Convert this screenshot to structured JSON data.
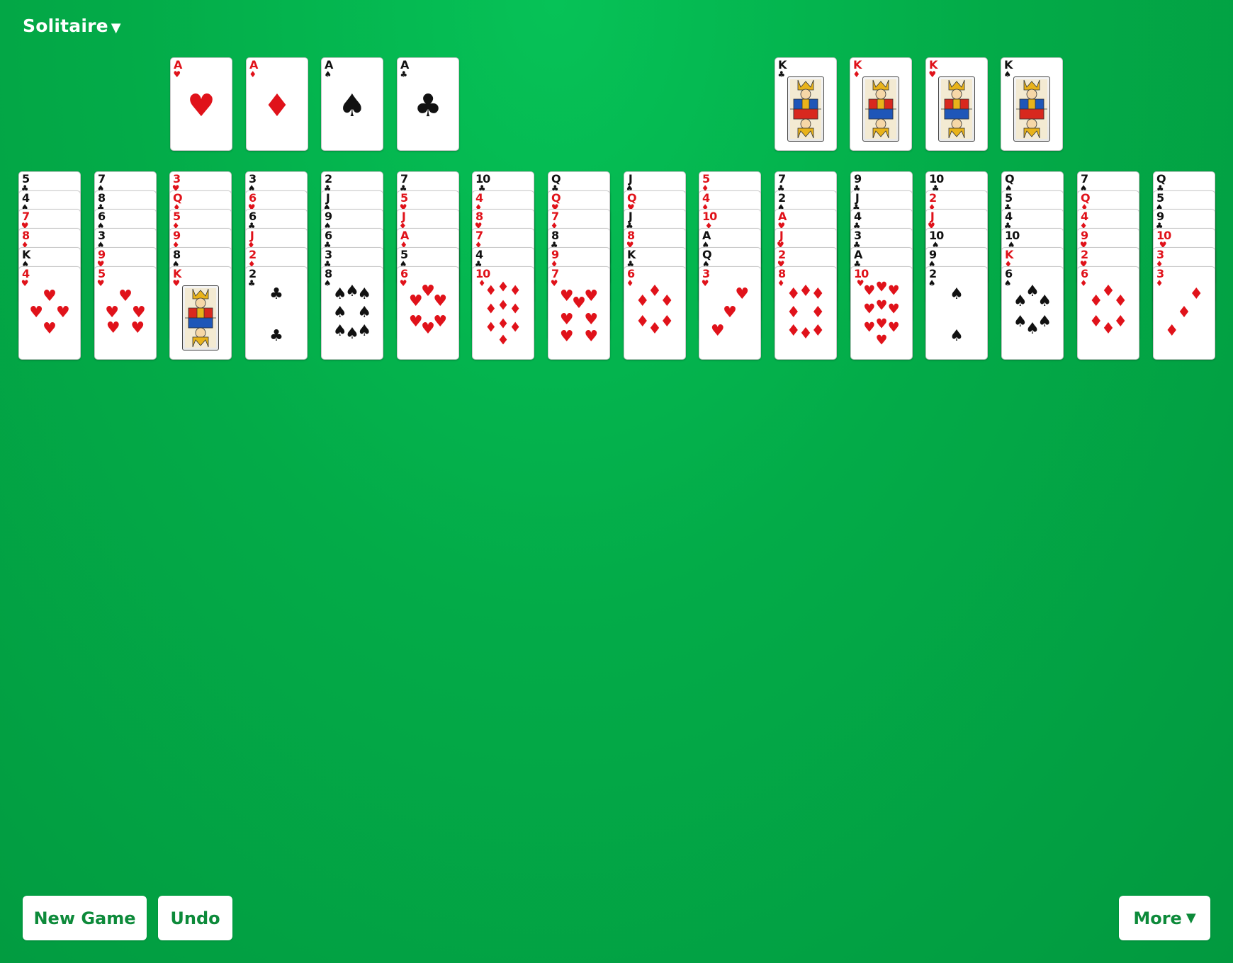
{
  "header": {
    "title": "Solitaire",
    "title_caret": "▼"
  },
  "buttons": {
    "new_game": "New Game",
    "undo": "Undo",
    "more": "More",
    "more_caret": "▼"
  },
  "colors": {
    "felt": "#03ab48",
    "red_suit": "#e0121a",
    "black_suit": "#111111",
    "button_text": "#0d8a3a"
  },
  "suit_symbols": {
    "hearts": "♥",
    "diamonds": "♦",
    "spades": "♠",
    "clubs": "♣"
  },
  "foundations_left": [
    {
      "rank": "A",
      "suit": "hearts"
    },
    {
      "rank": "A",
      "suit": "diamonds"
    },
    {
      "rank": "A",
      "suit": "spades"
    },
    {
      "rank": "A",
      "suit": "clubs"
    }
  ],
  "foundations_right": [
    {
      "rank": "K",
      "suit": "clubs"
    },
    {
      "rank": "K",
      "suit": "diamonds"
    },
    {
      "rank": "K",
      "suit": "hearts"
    },
    {
      "rank": "K",
      "suit": "spades"
    }
  ],
  "tableau": [
    [
      {
        "rank": "5",
        "suit": "clubs"
      },
      {
        "rank": "4",
        "suit": "spades"
      },
      {
        "rank": "7",
        "suit": "hearts"
      },
      {
        "rank": "8",
        "suit": "diamonds"
      },
      {
        "rank": "K",
        "suit": "spades"
      },
      {
        "rank": "4",
        "suit": "hearts"
      }
    ],
    [
      {
        "rank": "7",
        "suit": "spades"
      },
      {
        "rank": "8",
        "suit": "clubs"
      },
      {
        "rank": "6",
        "suit": "spades"
      },
      {
        "rank": "3",
        "suit": "spades"
      },
      {
        "rank": "9",
        "suit": "hearts"
      },
      {
        "rank": "5",
        "suit": "hearts"
      }
    ],
    [
      {
        "rank": "3",
        "suit": "hearts"
      },
      {
        "rank": "Q",
        "suit": "diamonds"
      },
      {
        "rank": "5",
        "suit": "diamonds"
      },
      {
        "rank": "9",
        "suit": "diamonds"
      },
      {
        "rank": "8",
        "suit": "spades"
      },
      {
        "rank": "K",
        "suit": "hearts"
      }
    ],
    [
      {
        "rank": "3",
        "suit": "spades"
      },
      {
        "rank": "6",
        "suit": "hearts"
      },
      {
        "rank": "6",
        "suit": "clubs"
      },
      {
        "rank": "J",
        "suit": "diamonds"
      },
      {
        "rank": "2",
        "suit": "diamonds"
      },
      {
        "rank": "2",
        "suit": "clubs"
      }
    ],
    [
      {
        "rank": "2",
        "suit": "clubs"
      },
      {
        "rank": "J",
        "suit": "spades"
      },
      {
        "rank": "9",
        "suit": "spades"
      },
      {
        "rank": "6",
        "suit": "clubs"
      },
      {
        "rank": "3",
        "suit": "clubs"
      },
      {
        "rank": "8",
        "suit": "spades"
      }
    ],
    [
      {
        "rank": "7",
        "suit": "clubs"
      },
      {
        "rank": "5",
        "suit": "hearts"
      },
      {
        "rank": "J",
        "suit": "diamonds"
      },
      {
        "rank": "A",
        "suit": "diamonds"
      },
      {
        "rank": "5",
        "suit": "spades"
      },
      {
        "rank": "6",
        "suit": "hearts"
      }
    ],
    [
      {
        "rank": "10",
        "suit": "clubs"
      },
      {
        "rank": "4",
        "suit": "diamonds"
      },
      {
        "rank": "8",
        "suit": "hearts"
      },
      {
        "rank": "7",
        "suit": "diamonds"
      },
      {
        "rank": "4",
        "suit": "clubs"
      },
      {
        "rank": "10",
        "suit": "diamonds"
      }
    ],
    [
      {
        "rank": "Q",
        "suit": "clubs"
      },
      {
        "rank": "Q",
        "suit": "hearts"
      },
      {
        "rank": "7",
        "suit": "diamonds"
      },
      {
        "rank": "8",
        "suit": "clubs"
      },
      {
        "rank": "9",
        "suit": "diamonds"
      },
      {
        "rank": "7",
        "suit": "hearts"
      }
    ],
    [
      {
        "rank": "J",
        "suit": "spades"
      },
      {
        "rank": "Q",
        "suit": "hearts"
      },
      {
        "rank": "J",
        "suit": "clubs"
      },
      {
        "rank": "8",
        "suit": "hearts"
      },
      {
        "rank": "K",
        "suit": "clubs"
      },
      {
        "rank": "6",
        "suit": "diamonds"
      }
    ],
    [
      {
        "rank": "5",
        "suit": "diamonds"
      },
      {
        "rank": "4",
        "suit": "diamonds"
      },
      {
        "rank": "10",
        "suit": "diamonds"
      },
      {
        "rank": "A",
        "suit": "spades"
      },
      {
        "rank": "Q",
        "suit": "spades"
      },
      {
        "rank": "3",
        "suit": "hearts"
      }
    ],
    [
      {
        "rank": "7",
        "suit": "clubs"
      },
      {
        "rank": "2",
        "suit": "spades"
      },
      {
        "rank": "A",
        "suit": "hearts"
      },
      {
        "rank": "J",
        "suit": "hearts"
      },
      {
        "rank": "2",
        "suit": "hearts"
      },
      {
        "rank": "8",
        "suit": "diamonds"
      }
    ],
    [
      {
        "rank": "9",
        "suit": "clubs"
      },
      {
        "rank": "J",
        "suit": "clubs"
      },
      {
        "rank": "4",
        "suit": "clubs"
      },
      {
        "rank": "3",
        "suit": "clubs"
      },
      {
        "rank": "A",
        "suit": "clubs"
      },
      {
        "rank": "10",
        "suit": "hearts"
      }
    ],
    [
      {
        "rank": "10",
        "suit": "clubs"
      },
      {
        "rank": "2",
        "suit": "diamonds"
      },
      {
        "rank": "J",
        "suit": "hearts"
      },
      {
        "rank": "10",
        "suit": "spades"
      },
      {
        "rank": "9",
        "suit": "spades"
      },
      {
        "rank": "2",
        "suit": "spades"
      }
    ],
    [
      {
        "rank": "Q",
        "suit": "spades"
      },
      {
        "rank": "5",
        "suit": "clubs"
      },
      {
        "rank": "4",
        "suit": "clubs"
      },
      {
        "rank": "10",
        "suit": "spades"
      },
      {
        "rank": "K",
        "suit": "diamonds"
      },
      {
        "rank": "6",
        "suit": "spades"
      }
    ],
    [
      {
        "rank": "7",
        "suit": "spades"
      },
      {
        "rank": "Q",
        "suit": "diamonds"
      },
      {
        "rank": "4",
        "suit": "diamonds"
      },
      {
        "rank": "9",
        "suit": "hearts"
      },
      {
        "rank": "2",
        "suit": "hearts"
      },
      {
        "rank": "6",
        "suit": "diamonds"
      }
    ],
    [
      {
        "rank": "Q",
        "suit": "clubs"
      },
      {
        "rank": "5",
        "suit": "spades"
      },
      {
        "rank": "9",
        "suit": "clubs"
      },
      {
        "rank": "10",
        "suit": "hearts"
      },
      {
        "rank": "3",
        "suit": "diamonds"
      },
      {
        "rank": "3",
        "suit": "diamonds"
      }
    ]
  ]
}
